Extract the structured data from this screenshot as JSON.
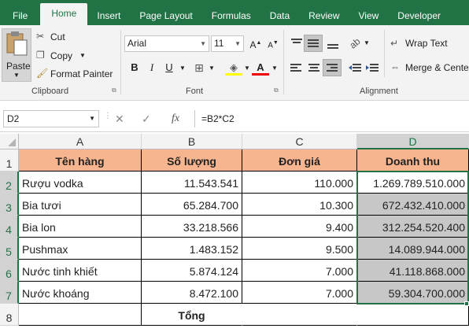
{
  "tabs": [
    "File",
    "Home",
    "Insert",
    "Page Layout",
    "Formulas",
    "Data",
    "Review",
    "View",
    "Developer"
  ],
  "active_tab": "Home",
  "clipboard": {
    "paste": "Paste",
    "cut": "Cut",
    "copy": "Copy",
    "format_painter": "Format Painter",
    "label": "Clipboard"
  },
  "font": {
    "name": "Arial",
    "size": "11",
    "label": "Font"
  },
  "alignment": {
    "wrap": "Wrap Text",
    "merge": "Merge & Cente",
    "label": "Alignment"
  },
  "name_box": "D2",
  "fx": "fx",
  "formula": "=B2*C2",
  "columns": [
    "A",
    "B",
    "C",
    "D"
  ],
  "rows": [
    "1",
    "2",
    "3",
    "4",
    "5",
    "6",
    "7",
    "8"
  ],
  "headers": [
    "Tên hàng",
    "Số lượng",
    "Đơn giá",
    "Doanh thu"
  ],
  "data": [
    [
      "Rượu vodka",
      "11.543.541",
      "110.000",
      "1.269.789.510.000"
    ],
    [
      "Bia tươi",
      "65.284.700",
      "10.300",
      "672.432.410.000"
    ],
    [
      "Bia lon",
      "33.218.566",
      "9.400",
      "312.254.520.400"
    ],
    [
      "Pushmax",
      "1.483.152",
      "9.500",
      "14.089.944.000"
    ],
    [
      "Nước tinh khiết",
      "5.874.124",
      "7.000",
      "41.118.868.000"
    ],
    [
      "Nước khoáng",
      "8.472.100",
      "7.000",
      "59.304.700.000"
    ]
  ],
  "total_label": "Tổng",
  "colors": {
    "excel_green": "#217346",
    "header_fill": "#f6b58e",
    "selection": "#c7c7c7"
  }
}
